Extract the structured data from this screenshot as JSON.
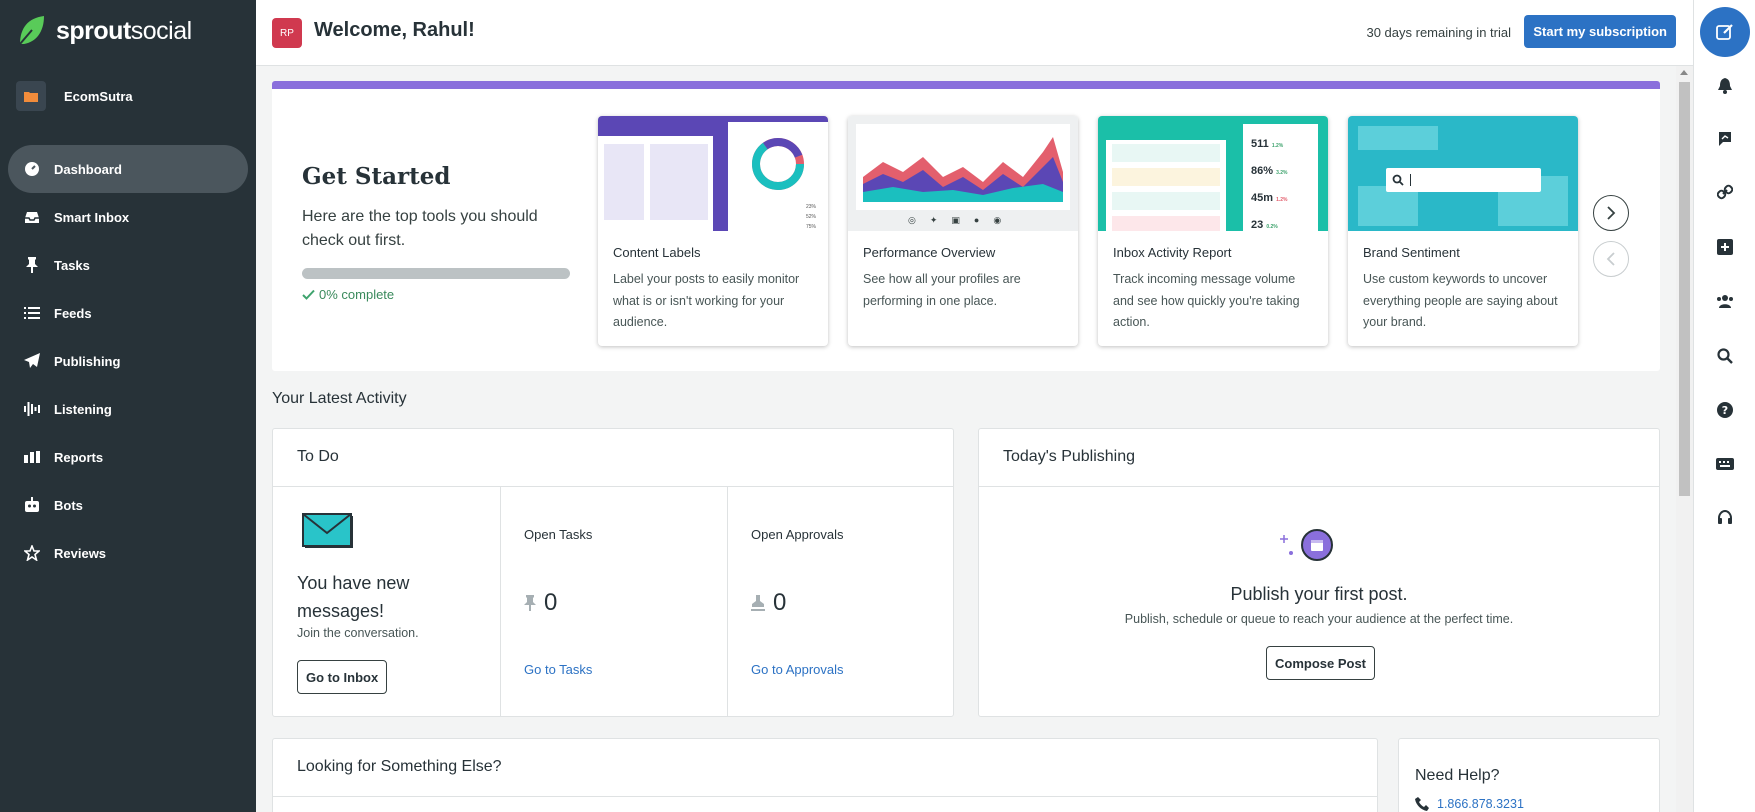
{
  "brand": {
    "name_bold": "sprout",
    "name_light": "social"
  },
  "account": {
    "name": "EcomSutra"
  },
  "nav": [
    {
      "label": "Dashboard",
      "icon": "dashboard-icon",
      "active": true
    },
    {
      "label": "Smart Inbox",
      "icon": "inbox-icon"
    },
    {
      "label": "Tasks",
      "icon": "pin-icon"
    },
    {
      "label": "Feeds",
      "icon": "list-icon"
    },
    {
      "label": "Publishing",
      "icon": "paper-plane-icon"
    },
    {
      "label": "Listening",
      "icon": "sound-wave-icon"
    },
    {
      "label": "Reports",
      "icon": "bar-chart-icon"
    },
    {
      "label": "Bots",
      "icon": "bot-icon"
    },
    {
      "label": "Reviews",
      "icon": "star-icon"
    }
  ],
  "header": {
    "avatar_initials": "RP",
    "welcome": "Welcome, Rahul!",
    "trial_text": "30 days remaining in trial",
    "subscribe_label": "Start my subscription"
  },
  "get_started": {
    "title": "Get Started",
    "subtitle": "Here are the top tools you should check out first.",
    "progress": 0,
    "complete_label": "0% complete",
    "tools": [
      {
        "title": "Content Labels",
        "desc": "Label your posts to easily monitor what is or isn't working for your audience."
      },
      {
        "title": "Performance Overview",
        "desc": "See how all your profiles are performing in one place."
      },
      {
        "title": "Inbox Activity Report",
        "desc": "Track incoming message volume and see how quickly you're taking action."
      },
      {
        "title": "Brand Sentiment",
        "desc": "Use custom keywords to uncover everything people are saying about your brand."
      }
    ],
    "inbox_stats": [
      {
        "value": "511",
        "change": "1.2%"
      },
      {
        "value": "86%",
        "change": "3.2%"
      },
      {
        "value": "45m",
        "change": "1.2%"
      },
      {
        "value": "23",
        "change": "0.2%"
      }
    ],
    "donut_legend": [
      "23%",
      "52%",
      "75%"
    ]
  },
  "activity": {
    "section_title": "Your Latest Activity",
    "todo": {
      "title": "To Do",
      "messages_title": "You have new messages!",
      "messages_sub": "Join the conversation.",
      "inbox_btn": "Go to Inbox",
      "open_tasks_label": "Open Tasks",
      "open_tasks_count": "0",
      "tasks_link": "Go to Tasks",
      "open_approvals_label": "Open Approvals",
      "open_approvals_count": "0",
      "approvals_link": "Go to Approvals"
    },
    "publishing": {
      "title": "Today's Publishing",
      "headline": "Publish your first post.",
      "sub": "Publish, schedule or queue to reach your audience at the perfect time.",
      "compose_btn": "Compose Post"
    }
  },
  "looking": {
    "title": "Looking for Something Else?"
  },
  "help": {
    "title": "Need Help?",
    "phone": "1.866.878.3231"
  },
  "colors": {
    "sidebar": "#273238",
    "accent": "#2c72c4",
    "progress_bar": "#8a6fdc",
    "success": "#3ea36d"
  }
}
